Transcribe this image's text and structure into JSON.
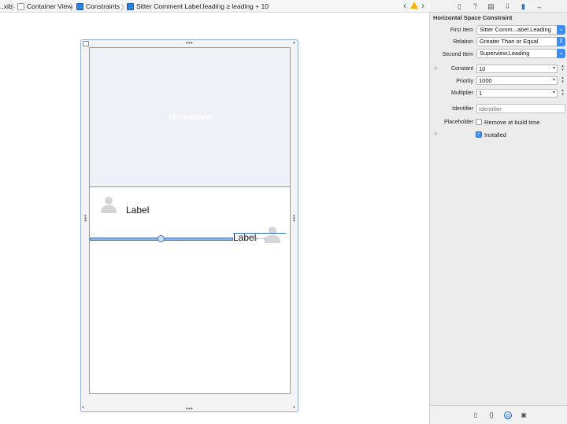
{
  "jumpbar": {
    "file": "..xib",
    "container": "Container View",
    "constraints": "Constraints",
    "constraint": "Sitter Comment Label.leading ≥ leading + 10",
    "back": "‹",
    "forward": "›"
  },
  "canvas": {
    "scroll_view_label": "UIScrollView",
    "cell_label_1": "Label",
    "cell_label_2": "Label"
  },
  "inspector": {
    "title": "Horizontal Space Constraint",
    "first_item_label": "First Item",
    "first_item_value": "Sitter Comm...abel.Leading",
    "relation_label": "Relation",
    "relation_value": "Greater Than or Equal",
    "second_item_label": "Second Item",
    "second_item_value": "Superview.Leading",
    "constant_label": "Constant",
    "constant_value": "10",
    "priority_label": "Priority",
    "priority_value": "1000",
    "multiplier_label": "Multiplier",
    "multiplier_value": "1",
    "identifier_label": "Identifier",
    "identifier_placeholder": "Identifier",
    "placeholder_label": "Placeholder",
    "remove_at_build_time": "Remove at build time",
    "installed": "Installed"
  },
  "colors": {
    "accent": "#3c8ef5",
    "warning": "#f5b400",
    "selection": "#2f6fd0"
  }
}
